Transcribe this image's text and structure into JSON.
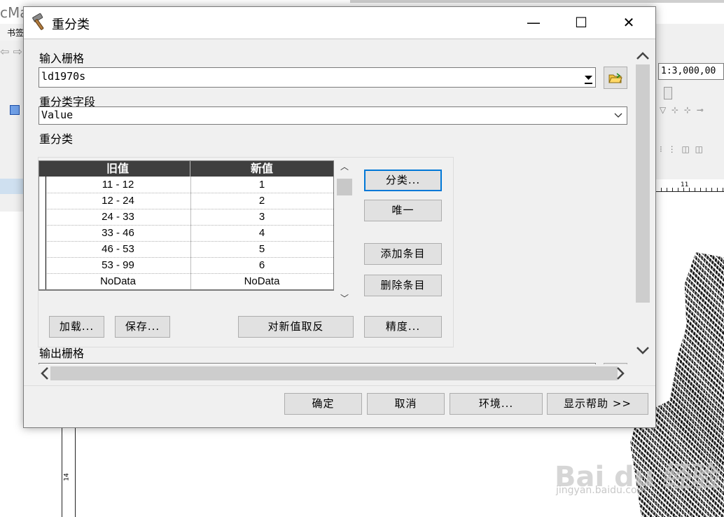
{
  "background": {
    "app_title": "cMa",
    "menu_item": "书签",
    "scale_value": "1:3,000,00",
    "ruler_h_label": "11",
    "ruler_v_label": "14",
    "watermark": "Bai du 经验",
    "watermark_sub": "jingyan.baidu.com"
  },
  "dialog": {
    "title": "重分类",
    "controls": {
      "minimize": "—",
      "maximize": "☐",
      "close": "✕"
    },
    "input_raster": {
      "label": "输入栅格",
      "value": "ld1970s"
    },
    "reclass_field": {
      "label": "重分类字段",
      "value": "Value"
    },
    "reclassification": {
      "label": "重分类",
      "columns": [
        "旧值",
        "新值"
      ],
      "rows": [
        {
          "old": "11 - 12",
          "new": "1"
        },
        {
          "old": "12 - 24",
          "new": "2"
        },
        {
          "old": "24 - 33",
          "new": "3"
        },
        {
          "old": "33 - 46",
          "new": "4"
        },
        {
          "old": "46 - 53",
          "new": "5"
        },
        {
          "old": "53 - 99",
          "new": "6"
        },
        {
          "old": "NoData",
          "new": "NoData"
        }
      ],
      "buttons": {
        "classify": "分类...",
        "unique": "唯一",
        "add_entry": "添加条目",
        "delete_entry": "删除条目",
        "load": "加载...",
        "save": "保存...",
        "reverse": "对新值取反",
        "precision": "精度..."
      }
    },
    "output_raster": {
      "label": "输出栅格"
    },
    "footer": {
      "ok": "确定",
      "cancel": "取消",
      "environments": "环境...",
      "show_help": "显示帮助 >>"
    }
  }
}
